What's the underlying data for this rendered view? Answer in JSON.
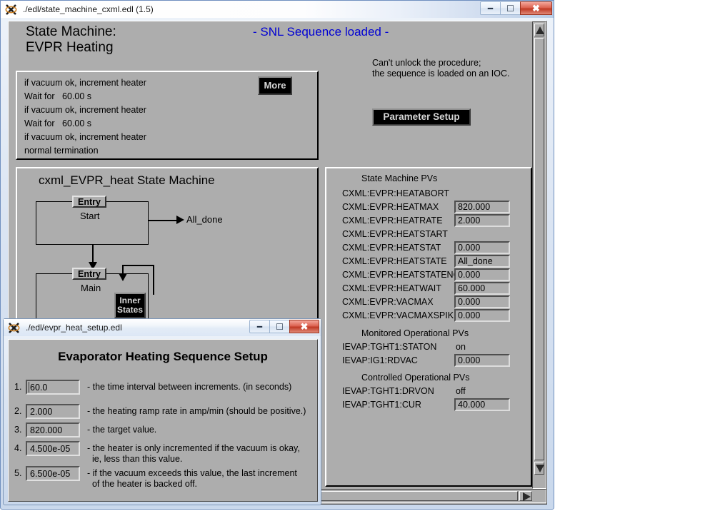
{
  "main_window": {
    "title": "./edl/state_machine_cxml.edl (1.5)",
    "controls": {
      "minimize": "–",
      "maximize": "❐",
      "close": "✕"
    },
    "header": {
      "title_line1": "State Machine:",
      "title_line2": "EVPR Heating",
      "status": "- SNL Sequence loaded -",
      "note_line1": "Can't unlock the procedure;",
      "note_line2": "the sequence is loaded on an IOC.",
      "parameter_setup_label": "Parameter Setup"
    },
    "sequence_box": {
      "more_label": "More",
      "lines": [
        "if vacuum ok, increment heater",
        "Wait for   60.00 s",
        "if vacuum ok, increment heater",
        "Wait for   60.00 s",
        "if vacuum ok, increment heater",
        "normal termination"
      ]
    },
    "state_machine": {
      "title": "cxml_EVPR_heat State Machine",
      "entry_tag": "Entry",
      "state_start": "Start",
      "state_main": "Main",
      "transition_label": "All_done",
      "inner_states_label_line1": "Inner",
      "inner_states_label_line2": "States"
    },
    "pv_panel": {
      "section_state_machine": "State Machine PVs",
      "section_monitored": "Monitored Operational PVs",
      "section_controlled": "Controlled Operational PVs",
      "state_machine_pvs": [
        {
          "name": "CXML:EVPR:HEATABORT",
          "value": "",
          "has_field": false
        },
        {
          "name": "CXML:EVPR:HEATMAX",
          "value": "820.000",
          "has_field": true
        },
        {
          "name": "CXML:EVPR:HEATRATE",
          "value": "2.000",
          "has_field": true
        },
        {
          "name": "CXML:EVPR:HEATSTART",
          "value": "",
          "has_field": false
        },
        {
          "name": "CXML:EVPR:HEATSTAT",
          "value": "0.000",
          "has_field": true
        },
        {
          "name": "CXML:EVPR:HEATSTATE",
          "value": "All_done",
          "has_field": true
        },
        {
          "name": "CXML:EVPR:HEATSTATENO",
          "value": "0.000",
          "has_field": true
        },
        {
          "name": "CXML:EVPR:HEATWAIT",
          "value": "60.000",
          "has_field": true
        },
        {
          "name": "CXML:EVPR:VACMAX",
          "value": "0.000",
          "has_field": true
        },
        {
          "name": "CXML:EVPR:VACMAXSPIKE",
          "value": "0.000",
          "has_field": true
        }
      ],
      "monitored_pvs": [
        {
          "name": "IEVAP:TGHT1:STATON",
          "value": "on",
          "has_field": false
        },
        {
          "name": "IEVAP:IG1:RDVAC",
          "value": "0.000",
          "has_field": true
        }
      ],
      "controlled_pvs": [
        {
          "name": "IEVAP:TGHT1:DRVON",
          "value": "off",
          "has_field": false
        },
        {
          "name": "IEVAP:TGHT1:CUR",
          "value": "40.000",
          "has_field": true
        }
      ]
    }
  },
  "dialog_window": {
    "title": "./edl/evpr_heat_setup.edl",
    "controls": {
      "minimize": "–",
      "maximize": "❐",
      "close": "✕"
    },
    "heading": "Evaporator Heating Sequence Setup",
    "rows": [
      {
        "num": "1.",
        "value": "60.0",
        "desc": "- the time interval between increments. (in seconds)"
      },
      {
        "num": "2.",
        "value": "2.000",
        "desc": "- the heating ramp rate in amp/min (should be positive.)"
      },
      {
        "num": "3.",
        "value": "820.000",
        "desc": "- the target value."
      },
      {
        "num": "4.",
        "value": "4.500e-05",
        "desc": "- the heater is only incremented if the vacuum is okay,\n  ie, less than this value."
      },
      {
        "num": "5.",
        "value": "6.500e-05",
        "desc": "- if the vacuum exceeds this value, the last increment\n  of the heater is backed off."
      }
    ]
  },
  "colors": {
    "edm_background": "#adadad",
    "status_blue": "#0000d4",
    "button_black": "#000000",
    "button_text": "#d6d6d6",
    "close_red": "#c03a25"
  }
}
